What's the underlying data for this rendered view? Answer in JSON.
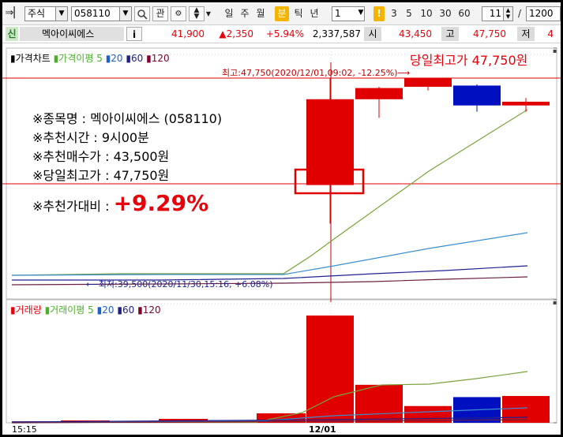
{
  "toolbar": {
    "market_select": "주식",
    "code_input": "058110",
    "search_icon": "search-icon",
    "watch_button": "관",
    "periods": [
      "일",
      "주",
      "월",
      "분",
      "틱",
      "년"
    ],
    "active_period": "분",
    "interval_value": "1",
    "info_badge": "!",
    "minute_presets": [
      "3",
      "5",
      "10",
      "30",
      "60"
    ],
    "count_value": "11",
    "separator": "/",
    "total_value": "1200"
  },
  "quote": {
    "tag": "신",
    "name": "멕아이씨에스",
    "info_button": "i",
    "price": "41,900",
    "change": "▲2,350",
    "change_pct": "+5.94%",
    "volume": "2,337,587",
    "open_label": "시",
    "open_value": "43,450",
    "high_label": "고",
    "high_value": "47,750",
    "low_label": "저",
    "low_value": "4"
  },
  "price_panel": {
    "title": "가격차트",
    "ma_label": "가격이평",
    "ma_periods": [
      "5",
      "20",
      "60",
      "120"
    ],
    "max_marker": "최고:47,750(2020/12/01,09:02, -12.25%)⟶",
    "min_marker": "⟵최저:39,500(2020/11/30,15:16, +6.08%)",
    "headline": "당일최고가 47,750원"
  },
  "recommend": {
    "stock_line": "※종목명 : 멕아이씨에스 (058110)",
    "time_line": "※추천시간 : 9시00분",
    "buy_line": "※추천매수가 : 43,500원",
    "high_line": "※당일최고가 : 47,750원",
    "ratio_label": "※추천가대비 :",
    "ratio_value": "+9.29%"
  },
  "volume_panel": {
    "title": "거래량",
    "ma_label": "거래이평",
    "ma_periods": [
      "5",
      "20",
      "60",
      "120"
    ]
  },
  "time_axis": {
    "left_label": "15:15",
    "mid_label": "12/01"
  },
  "colors": {
    "up": "#e00000",
    "down": "#0010c0",
    "ma5": "#7aa23a",
    "ma20": "#3a8fd0",
    "ma60": "#202090",
    "ma120": "#6a2040",
    "accent": "#e8000a"
  },
  "chart_data": {
    "type": "candlestick",
    "candles": [
      {
        "open": 43450,
        "high": 47750,
        "low": 41900,
        "close": 46900,
        "color": "up"
      },
      {
        "open": 46900,
        "high": 47400,
        "low": 46150,
        "close": 47350,
        "color": "up"
      },
      {
        "open": 47400,
        "high": 47700,
        "low": 47250,
        "close": 47750,
        "color": "up"
      },
      {
        "open": 47450,
        "high": 47500,
        "low": 46400,
        "close": 46650,
        "color": "down"
      },
      {
        "open": 46650,
        "high": 46950,
        "low": 46400,
        "close": 46800,
        "color": "up"
      }
    ],
    "volumes": [
      480,
      170,
      75,
      115,
      120
    ],
    "recommend_price": 43500,
    "high": 47750,
    "low": 39500
  }
}
